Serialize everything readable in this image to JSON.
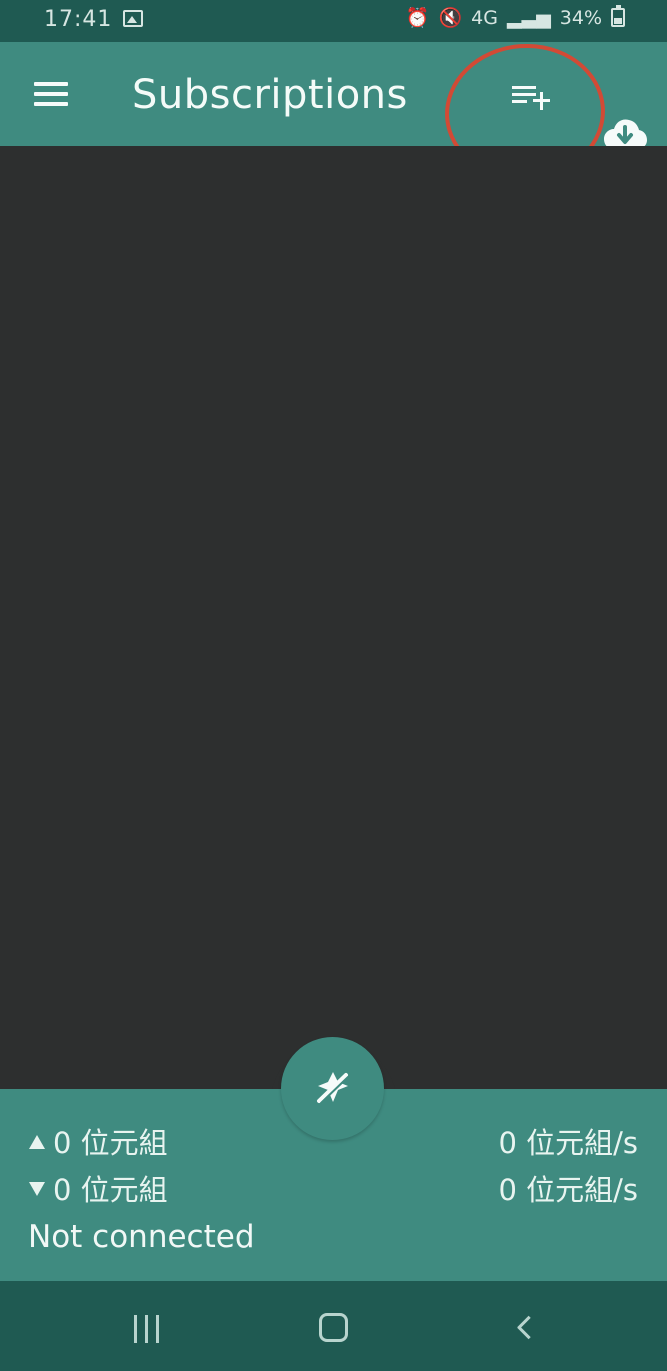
{
  "status_bar": {
    "time": "17:41",
    "network_label": "4G",
    "battery": "34%",
    "icons": [
      "image-icon",
      "alarm-icon",
      "mute-icon",
      "network-icon",
      "signal-icon",
      "battery-icon"
    ]
  },
  "app_bar": {
    "title": "Subscriptions",
    "menu_icon": "menu-icon",
    "add_subscription_icon": "playlist-add-icon",
    "download_icon": "cloud-download-icon"
  },
  "stats": {
    "upload_total": "0 位元組",
    "download_total": "0 位元組",
    "upload_speed": "0 位元組/s",
    "download_speed": "0 位元組/s",
    "status": "Not connected"
  },
  "nav_bar": {
    "recent_icon": "recent-apps-icon",
    "home_icon": "home-icon",
    "back_icon": "back-icon"
  },
  "colors": {
    "status_bar": "#1f5a52",
    "primary": "#3f8b80",
    "background": "#2d2f2f",
    "highlight": "#d24a35",
    "text": "#f4fbf8"
  }
}
